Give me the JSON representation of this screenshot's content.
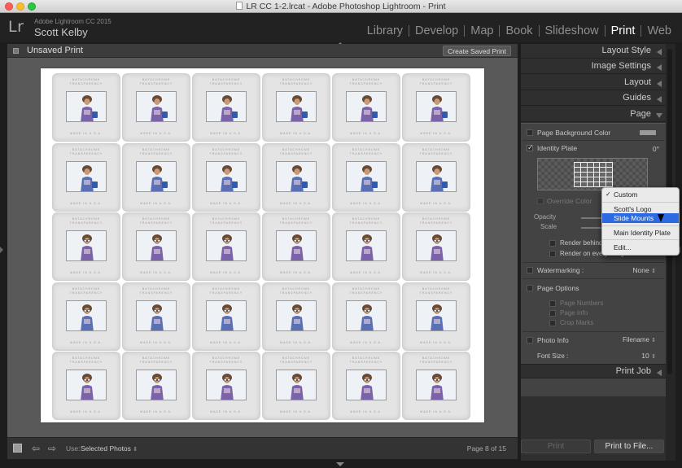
{
  "window": {
    "title": "LR CC 1-2.lrcat - Adobe Photoshop Lightroom - Print"
  },
  "identity": {
    "logo": "Lr",
    "product": "Adobe Lightroom CC 2015",
    "user": "Scott Kelby"
  },
  "modules": [
    {
      "label": "Library",
      "active": false
    },
    {
      "label": "Develop",
      "active": false
    },
    {
      "label": "Map",
      "active": false
    },
    {
      "label": "Book",
      "active": false
    },
    {
      "label": "Slideshow",
      "active": false
    },
    {
      "label": "Print",
      "active": true
    },
    {
      "label": "Web",
      "active": false
    }
  ],
  "center": {
    "title": "Unsaved Print",
    "create_button": "Create Saved Print",
    "mount_line1": "BATACHROME",
    "mount_line2": "TRANSPARENCY",
    "mount_bottom": "MADE IN U.S.A.",
    "grid": {
      "columns": 6,
      "rows": 5
    }
  },
  "toolbar": {
    "use_label": "Use:",
    "use_value": "Selected Photos",
    "page_indicator": "Page 8 of 15"
  },
  "right_panels": [
    "Layout Style",
    "Image Settings",
    "Layout",
    "Guides",
    "Page"
  ],
  "page_panel": {
    "page_bg_color": "Page Background Color",
    "identity_plate": "Identity Plate",
    "angle": "0°",
    "override_color": "Override Color",
    "opacity": "Opacity",
    "scale": "Scale",
    "render_behind": "Render behind",
    "render_every": "Render on every image",
    "watermarking": "Watermarking :",
    "watermark_value": "None",
    "page_options": "Page Options",
    "page_numbers": "Page Numbers",
    "page_info": "Page Info",
    "crop_marks": "Crop Marks",
    "photo_info": "Photo Info",
    "photo_info_value": "Filename",
    "font_size_label": "Font Size :",
    "font_size_value": "10"
  },
  "print_job": "Print Job",
  "popup_menu": [
    "Custom",
    "Scott's Logo",
    "Slide Mounts",
    "Main Identity Plate",
    "Edit..."
  ],
  "buttons": {
    "print": "Print",
    "print_to_file": "Print to File..."
  },
  "colors": {
    "accent": "#2b6ae0",
    "background": "#1d1d1d",
    "panel": "#434343"
  }
}
